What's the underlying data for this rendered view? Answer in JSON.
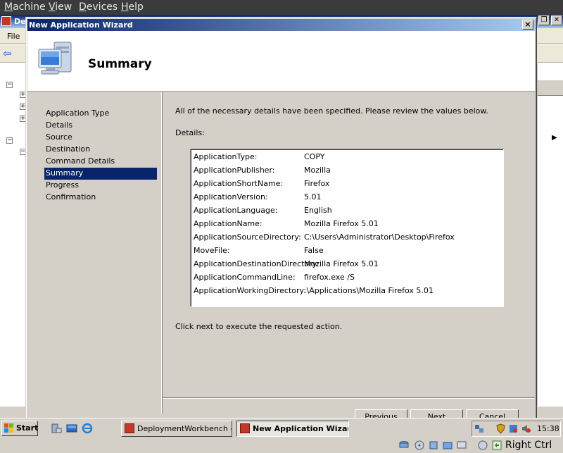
{
  "vbox_menu": {
    "machine": "Machine",
    "view": "View",
    "devices": "Devices",
    "help": "Help"
  },
  "bg_window": {
    "title_fragment": "De",
    "menu_file": "File"
  },
  "wizard": {
    "title": "New Application Wizard",
    "close_glyph": "×",
    "heading": "Summary",
    "nav": [
      {
        "label": "Application Type",
        "selected": false
      },
      {
        "label": "Details",
        "selected": false
      },
      {
        "label": "Source",
        "selected": false
      },
      {
        "label": "Destination",
        "selected": false
      },
      {
        "label": "Command Details",
        "selected": false
      },
      {
        "label": "Summary",
        "selected": true
      },
      {
        "label": "Progress",
        "selected": false
      },
      {
        "label": "Confirmation",
        "selected": false
      }
    ],
    "intro": "All of the necessary details have been specified.  Please review the values below.",
    "details_label": "Details:",
    "details": [
      {
        "key": "ApplicationType:",
        "value": "COPY"
      },
      {
        "key": "ApplicationPublisher:",
        "value": "Mozilla"
      },
      {
        "key": "ApplicationShortName:",
        "value": "Firefox"
      },
      {
        "key": "ApplicationVersion:",
        "value": "5.01"
      },
      {
        "key": "ApplicationLanguage:",
        "value": "English"
      },
      {
        "key": "ApplicationName:",
        "value": "Mozilla Firefox 5.01"
      },
      {
        "key": "ApplicationSourceDirectory:",
        "value": "C:\\Users\\Administrator\\Desktop\\Firefox"
      },
      {
        "key": "MoveFile:",
        "value": "False"
      },
      {
        "key": "ApplicationDestinationDirectory:",
        "value": "Mozilla Firefox 5.01"
      },
      {
        "key": "ApplicationCommandLine:",
        "value": "firefox.exe /S"
      },
      {
        "key": "ApplicationWorkingDirectory:",
        "value": ".\\Applications\\Mozilla Firefox 5.01"
      }
    ],
    "next_hint": "Click next to execute the requested action.",
    "buttons": {
      "previous": "Previous",
      "next": "Next",
      "cancel": "Cancel"
    }
  },
  "taskbar": {
    "start": "Start",
    "tasks": [
      {
        "label": "DeploymentWorkbench -...",
        "active": false
      },
      {
        "label": "New Application Wizard",
        "active": true
      }
    ],
    "clock": "15:38"
  },
  "vbox_status": {
    "host_key": "Right Ctrl"
  }
}
